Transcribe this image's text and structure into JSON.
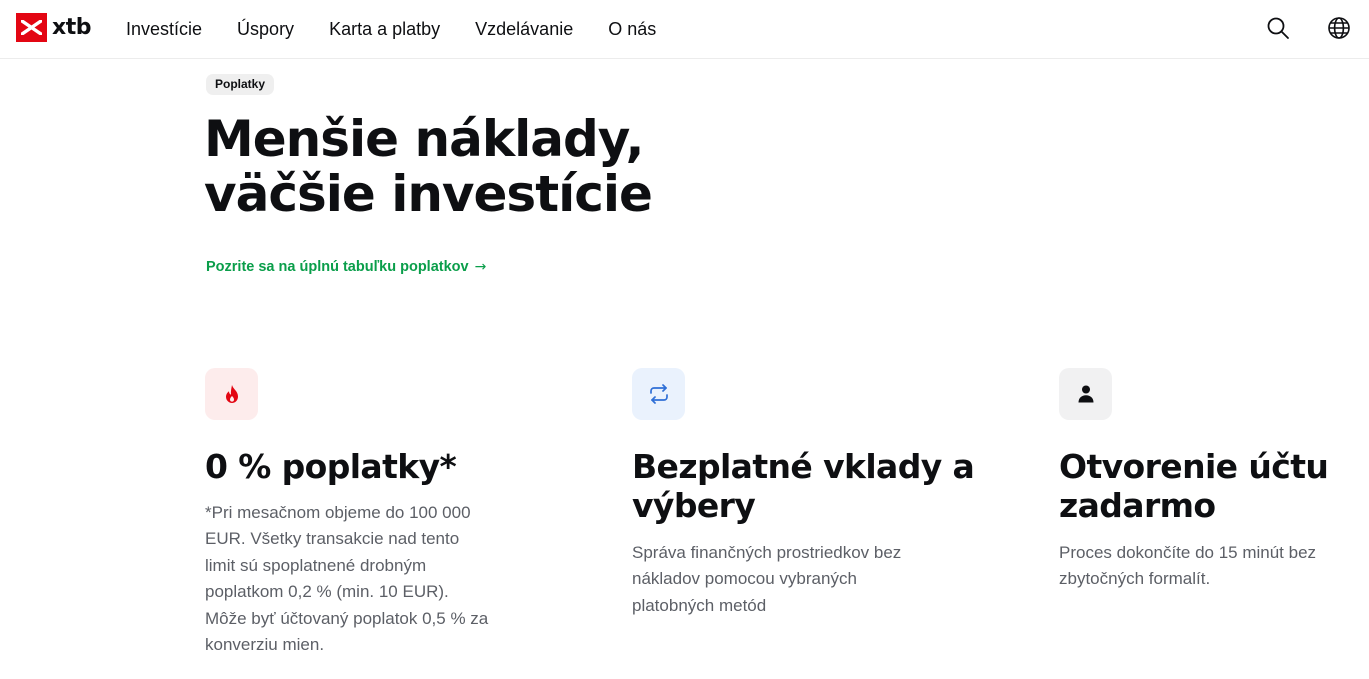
{
  "header": {
    "logo_text": "xtb",
    "nav": [
      {
        "label": "Investície"
      },
      {
        "label": "Úspory"
      },
      {
        "label": "Karta a platby"
      },
      {
        "label": "Vzdelávanie"
      },
      {
        "label": "O nás"
      }
    ],
    "icons": [
      "search-icon",
      "globe-icon"
    ]
  },
  "hero": {
    "badge": "Poplatky",
    "title_lines": [
      "Menšie náklady,",
      "väčšie investície"
    ],
    "link_text": "Pozrite sa na úplnú tabuľku poplatkov",
    "link_arrow": "→"
  },
  "features": [
    {
      "icon": "flame-icon",
      "title_lines": [
        "0 % poplatky*"
      ],
      "desc_lines": [
        "*Pri mesačnom objeme do 100 000",
        "EUR. Všetky transakcie nad tento",
        "limit sú spoplatnené drobným",
        "poplatkom 0,2 % (min. 10 EUR).",
        "Môže byť účtovaný poplatok 0,5 % za",
        "konverziu mien."
      ]
    },
    {
      "icon": "repeat-arrows-icon",
      "title_lines": [
        "Bezplatné vklady a",
        "výbery"
      ],
      "desc_lines": [
        "Správa finančných prostriedkov bez",
        "nákladov pomocou vybraných",
        "platobných metód"
      ]
    },
    {
      "icon": "user-icon",
      "title_lines": [
        "Otvorenie účtu",
        "zadarmo"
      ],
      "desc_lines": [
        "Proces dokončíte do 15 minút bez",
        "zbytočných formalít."
      ]
    }
  ],
  "colors": {
    "brand_red": "#e30613",
    "link_green": "#0a9e4a",
    "text_dark": "#0e0f12",
    "text_muted": "#5c5f66",
    "icon_bg_red": "#fdecec",
    "icon_bg_blue": "#eaf2fd",
    "icon_bg_grey": "#f1f1f2"
  }
}
